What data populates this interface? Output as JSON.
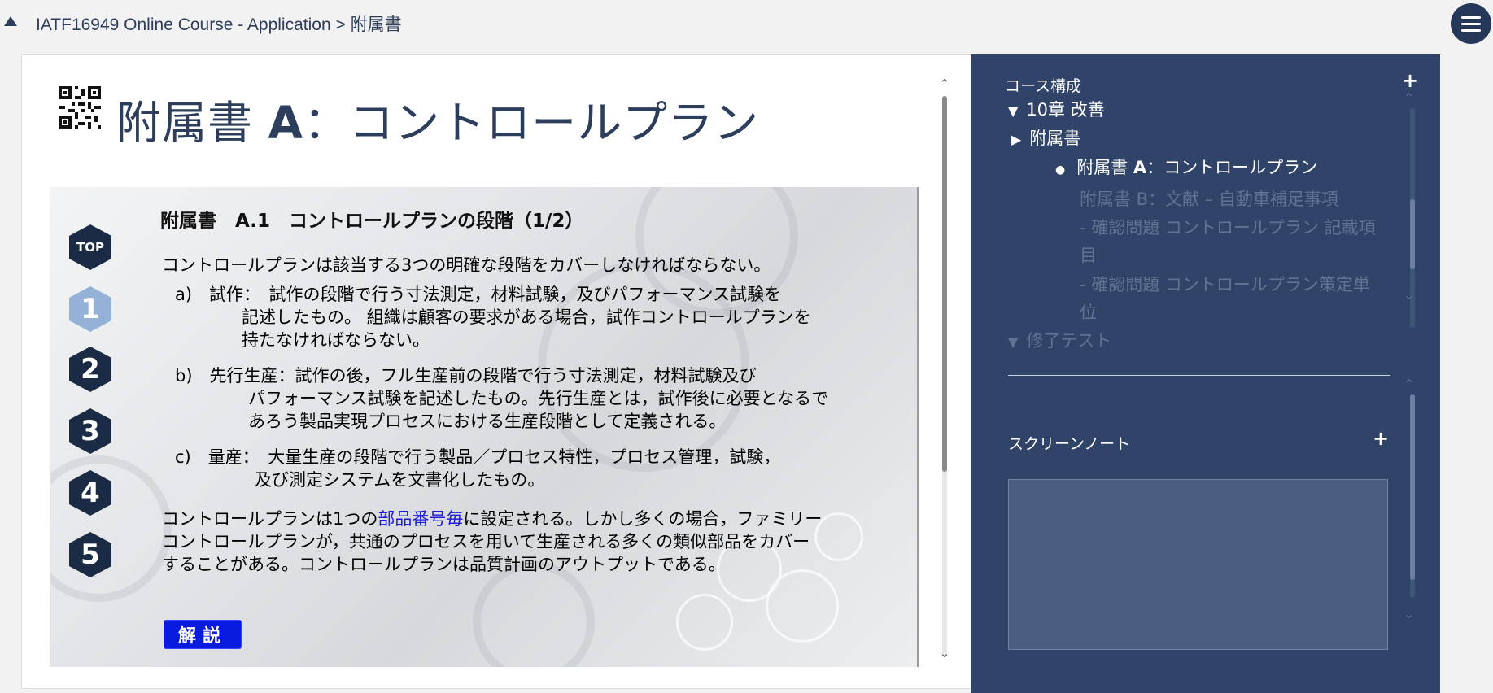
{
  "breadcrumb": "IATF16949 Online Course - Application > 附属書",
  "page": {
    "title_prefix": "附属書 ",
    "title_bold": "A",
    "title_suffix": "：コントロールプラン"
  },
  "slide": {
    "nav": [
      "TOP",
      "1",
      "2",
      "3",
      "4",
      "5"
    ],
    "section_title": "附属書　A.1　コントロールプランの段階（1/2）",
    "intro": "コントロールプランは該当する3つの明確な段階をカバーしなければならない。",
    "item_a": [
      "a)　試作：　試作の段階で行う寸法測定，材料試験，及びパフォーマンス試験を",
      "記述したもの。 組織は顧客の要求がある場合，試作コントロールプランを",
      "持たなければならない。"
    ],
    "item_b": [
      "b)　先行生産：試作の後，フル生産前の段階で行う寸法測定，材料試験及び",
      "パフォーマンス試験を記述したもの。先行生産とは，試作後に必要となるで",
      "あろう製品実現プロセスにおける生産段階として定義される。"
    ],
    "item_c": [
      "c)　量産：　大量生産の段階で行う製品／プロセス特性，プロセス管理，試験，",
      "及び測定システムを文書化したもの。"
    ],
    "closing_pre": "コントロールプランは1つの",
    "closing_link": "部品番号毎",
    "closing_post": "に設定される。しかし多くの場合，ファミリー",
    "closing_2": "コントロールプランが，共通のプロセスを用いて生産される多くの類似部品をカバー",
    "closing_3": "することがある。コントロールプランは品質計画のアウトプットである。",
    "explain_button": "解説"
  },
  "sidebar": {
    "course_header": "コース構成",
    "tree": {
      "chapter": "10章 改善",
      "annex": "附属書",
      "current": "附属書 A：コントロールプラン",
      "current_prefix": "附属書 ",
      "current_bold": "A",
      "current_suffix": "：コントロールプラン",
      "annex_b": "附属書 B：文献 – 自動車補足事項",
      "quiz1": "- 確認問題 コントロールプラン 記載項目",
      "quiz2": "- 確認問題 コントロールプラン策定単位",
      "final": "修了テスト"
    },
    "notes_header": "スクリーンノート"
  },
  "colors": {
    "sidebar_bg": "#2f4468",
    "title": "#2d3e5c",
    "nav_hex": "#1c2b45",
    "nav_active": "#94b2d8",
    "explain_button": "#0a1be0",
    "link": "#1a1adb"
  }
}
